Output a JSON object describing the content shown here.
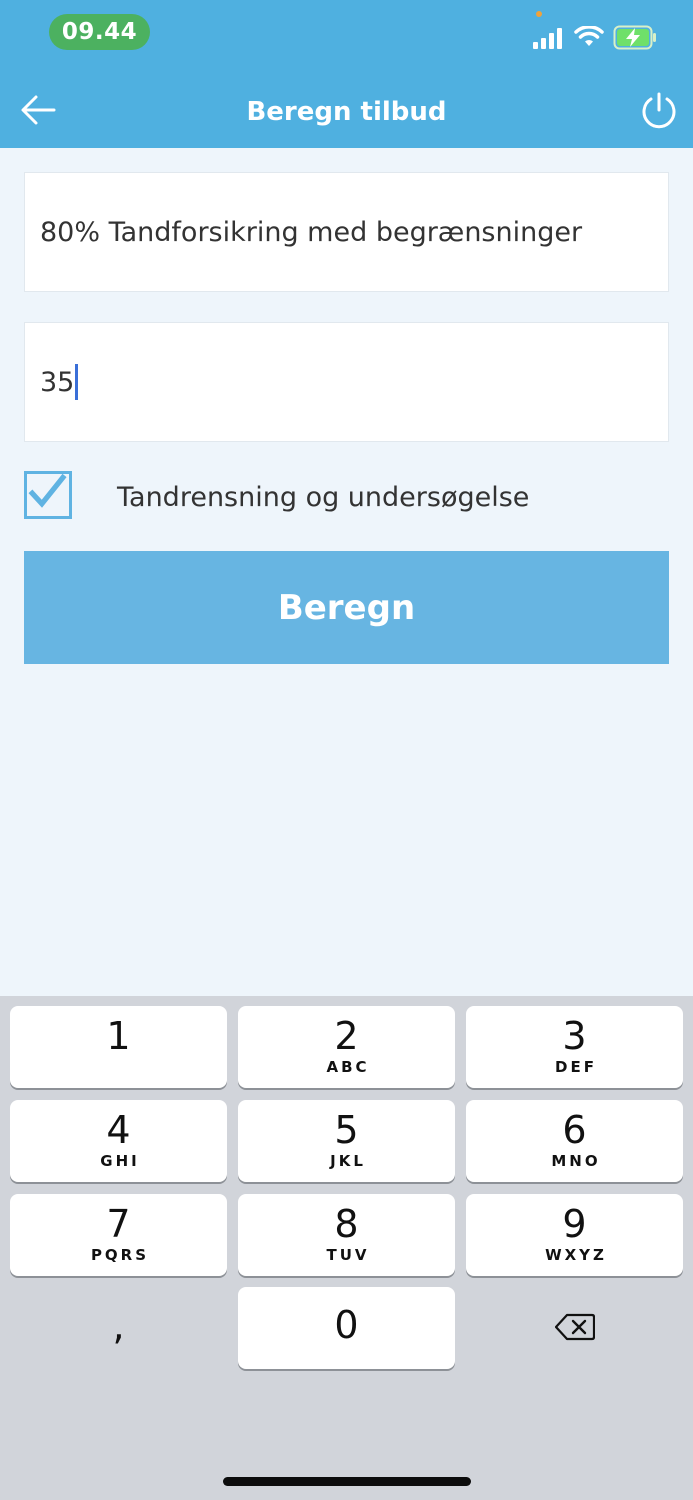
{
  "status_bar": {
    "time": "09.44"
  },
  "nav": {
    "title": "Beregn tilbud",
    "back_icon": "arrow-left-icon",
    "power_icon": "power-icon"
  },
  "form": {
    "plan_value": "80% Tandforsikring  med begrænsninger",
    "age_value": "35",
    "checkbox_label": "Tandrensning og undersøgelse",
    "checkbox_checked": true,
    "calculate_label": "Beregn"
  },
  "keypad": {
    "keys": [
      {
        "num": "1",
        "letters": ""
      },
      {
        "num": "2",
        "letters": "ABC"
      },
      {
        "num": "3",
        "letters": "DEF"
      },
      {
        "num": "4",
        "letters": "GHI"
      },
      {
        "num": "5",
        "letters": "JKL"
      },
      {
        "num": "6",
        "letters": "MNO"
      },
      {
        "num": "7",
        "letters": "PQRS"
      },
      {
        "num": "8",
        "letters": "TUV"
      },
      {
        "num": "9",
        "letters": "WXYZ"
      }
    ],
    "comma": ",",
    "zero": "0",
    "delete_icon": "backspace-icon"
  },
  "colors": {
    "header": "#4fb0e0",
    "button": "#67b5e2",
    "time_pill": "#4cb160",
    "background": "#eef5fb"
  }
}
